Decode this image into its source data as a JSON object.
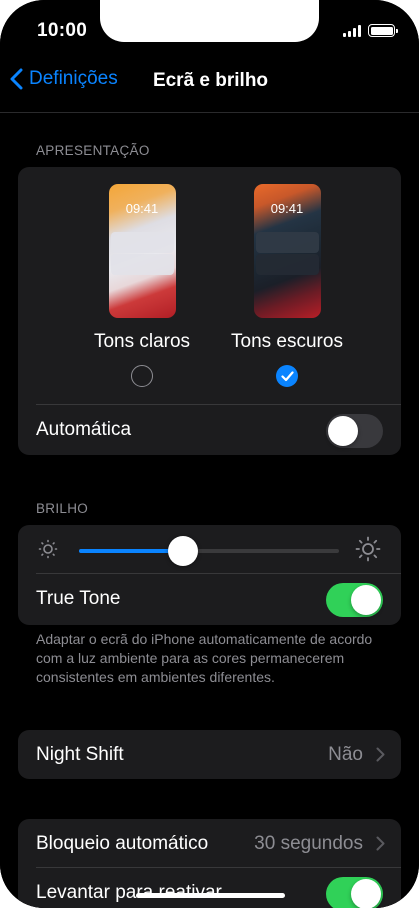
{
  "status_bar": {
    "time": "10:00"
  },
  "navbar": {
    "back_label": "Definições",
    "title": "Ecrã e brilho"
  },
  "appearance": {
    "header": "APRESENTAÇÃO",
    "preview_time": "09:41",
    "light_label": "Tons claros",
    "dark_label": "Tons escuros",
    "selected": "dark",
    "automatic_label": "Automática",
    "automatic_on": false
  },
  "brightness": {
    "header": "BRILHO",
    "level": 0.4,
    "true_tone_label": "True Tone",
    "true_tone_on": true,
    "footnote": "Adaptar o ecrã do iPhone automaticamente de acordo com a luz ambiente para as cores permanecerem consistentes em ambientes diferentes."
  },
  "night_shift": {
    "label": "Night Shift",
    "value": "Não"
  },
  "auto_lock": {
    "label": "Bloqueio automático",
    "value": "30 segundos"
  },
  "raise_to_wake": {
    "label": "Levantar para reativar",
    "on": true
  },
  "colors": {
    "accent": "#0a84ff",
    "toggle_on": "#30d158",
    "background": "#000000",
    "card": "#1c1c1e"
  }
}
